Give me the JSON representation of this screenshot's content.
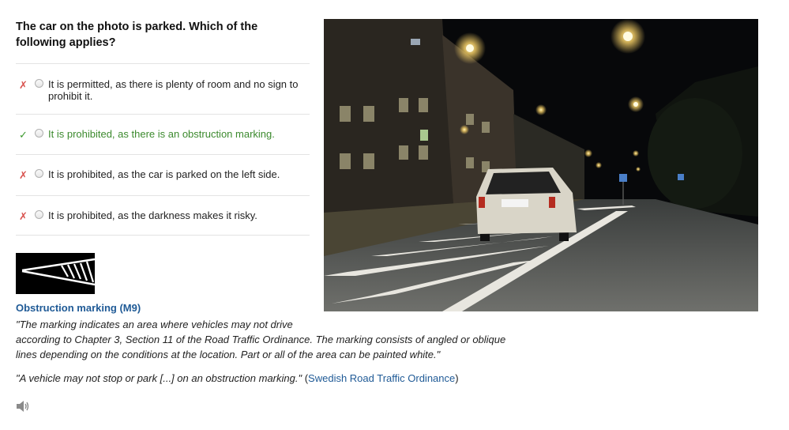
{
  "question": "The car on the photo is parked. Which of the following applies?",
  "options": [
    {
      "status": "wrong",
      "mark": "✗",
      "text": "It is permitted, as there is plenty of room and no sign to prohibit it."
    },
    {
      "status": "correct",
      "mark": "✓",
      "text": "It is prohibited, as there is an obstruction marking."
    },
    {
      "status": "wrong",
      "mark": "✗",
      "text": "It is prohibited, as the car is parked on the left side."
    },
    {
      "status": "wrong",
      "mark": "✗",
      "text": "It is prohibited, as the darkness makes it risky."
    }
  ],
  "explanation": {
    "sign_title": "Obstruction marking (M9)",
    "description_line1": "\"The marking indicates an area where vehicles may not drive",
    "description_line2": "according to Chapter 3, Section 11 of the Road Traffic Ordinance. The marking consists of angled or oblique lines depending on the conditions at the location. Part or all of the area can be painted white.\"",
    "quote": "\"A vehicle may not stop or park [...] on an obstruction marking.\"",
    "source_open": " (",
    "source_link": "Swedish Road Traffic Ordinance",
    "source_close": ")"
  },
  "icons": {
    "wrong": "cross-mark-icon",
    "correct": "check-mark-icon",
    "audio": "speaker-icon",
    "sign": "obstruction-marking-sign"
  },
  "colors": {
    "wrong": "#d9534f",
    "correct": "#3c8a2e",
    "link": "#1f5a96"
  }
}
